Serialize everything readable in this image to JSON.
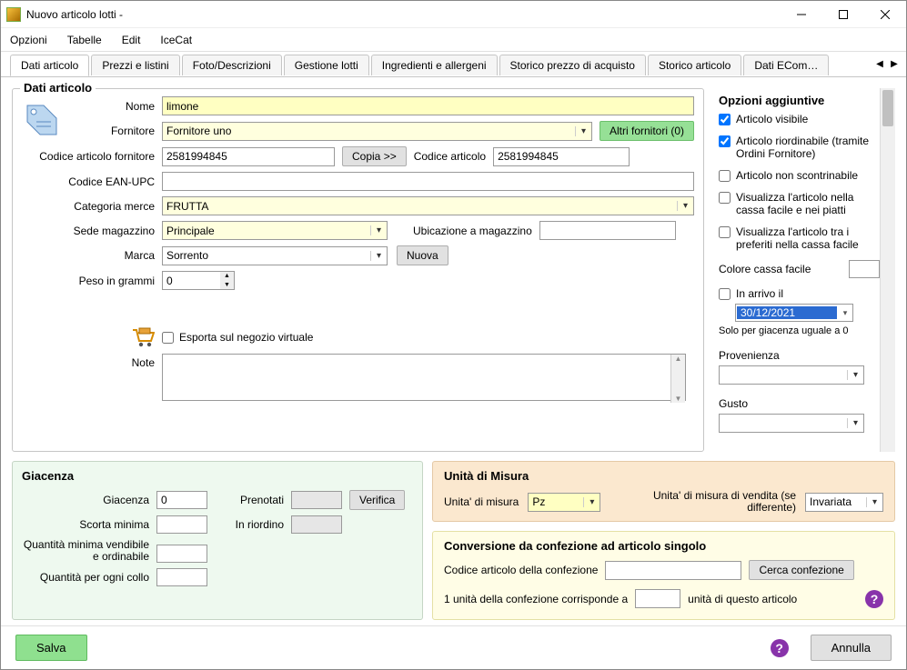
{
  "window": {
    "title": "Nuovo articolo lotti -"
  },
  "menubar": {
    "items": [
      "Opzioni",
      "Tabelle",
      "Edit",
      "IceCat"
    ]
  },
  "tabs": {
    "items": [
      "Dati articolo",
      "Prezzi e listini",
      "Foto/Descrizioni",
      "Gestione lotti",
      "Ingredienti e allergeni",
      "Storico prezzo di acquisto",
      "Storico articolo",
      "Dati ECom…"
    ],
    "active_index": 0
  },
  "dati_articolo": {
    "group_title": "Dati articolo",
    "labels": {
      "nome": "Nome",
      "fornitore": "Fornitore",
      "altri_fornitori": "Altri fornitori (0)",
      "codice_art_fornitore": "Codice articolo fornitore",
      "copia": "Copia >>",
      "codice_articolo": "Codice articolo",
      "codice_ean": "Codice EAN-UPC",
      "categoria": "Categoria merce",
      "sede": "Sede magazzino",
      "ubicazione": "Ubicazione a magazzino",
      "marca": "Marca",
      "nuova": "Nuova",
      "peso": "Peso in grammi",
      "esporta": "Esporta sul negozio virtuale",
      "note": "Note"
    },
    "values": {
      "nome": "limone",
      "fornitore": "Fornitore uno",
      "codice_art_fornitore": "2581994845",
      "codice_articolo": "2581994845",
      "codice_ean": "",
      "categoria": "FRUTTA",
      "sede": "Principale",
      "ubicazione": "",
      "marca": "Sorrento",
      "peso": "0",
      "esporta": false,
      "note": ""
    }
  },
  "opzioni": {
    "title": "Opzioni aggiuntive",
    "visibile": {
      "label": "Articolo visibile",
      "checked": true
    },
    "riordinabile": {
      "label": "Articolo riordinabile (tramite Ordini Fornitore)",
      "checked": true
    },
    "non_scontrinabile": {
      "label": "Articolo non scontrinabile",
      "checked": false
    },
    "cassa_facile": {
      "label": "Visualizza l'articolo nella cassa facile e nei piatti",
      "checked": false
    },
    "preferiti": {
      "label": "Visualizza l'articolo tra i preferiti nella cassa facile",
      "checked": false
    },
    "colore_label": "Colore cassa facile",
    "in_arrivo": {
      "label": "In arrivo il",
      "checked": false,
      "date": "30/12/2021",
      "note": "Solo per giacenza uguale a 0"
    },
    "provenienza": {
      "label": "Provenienza",
      "value": ""
    },
    "gusto": {
      "label": "Gusto",
      "value": ""
    }
  },
  "giacenza": {
    "title": "Giacenza",
    "labels": {
      "giacenza": "Giacenza",
      "prenotati": "Prenotati",
      "verifica": "Verifica",
      "scorta": "Scorta minima",
      "in_riordino": "In riordino",
      "q_min": "Quantità minima vendibile e ordinabile",
      "q_collo": "Quantità per ogni collo"
    },
    "values": {
      "giacenza": "0",
      "prenotati": "",
      "scorta": "",
      "in_riordino": "",
      "q_min": "",
      "q_collo": ""
    }
  },
  "um": {
    "title": "Unità di Misura",
    "unita_label": "Unita' di misura",
    "unita_value": "Pz",
    "vendita_label": "Unita' di misura di vendita (se differente)",
    "vendita_value": "Invariata"
  },
  "conv": {
    "title": "Conversione da confezione ad articolo singolo",
    "codice_label": "Codice articolo della confezione",
    "codice_value": "",
    "cerca": "Cerca confezione",
    "ratio_pre": "1 unità della confezione corrisponde a",
    "ratio_value": "",
    "ratio_post": "unità di questo articolo"
  },
  "footer": {
    "salva": "Salva",
    "annulla": "Annulla"
  }
}
